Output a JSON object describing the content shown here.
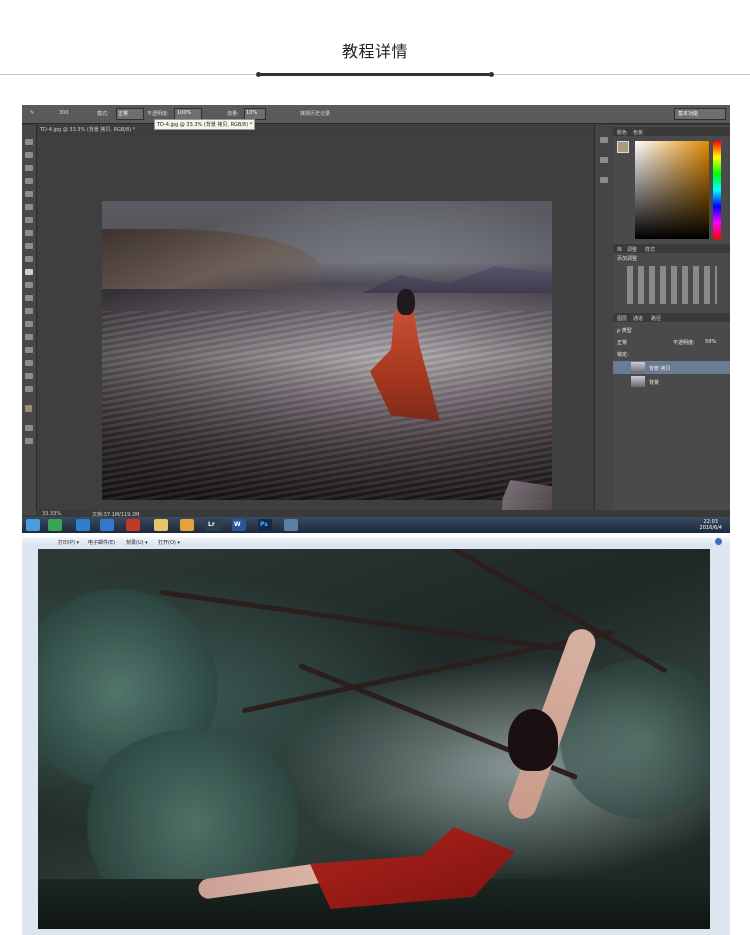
{
  "header": {
    "title": "教程详情"
  },
  "photoshop": {
    "options_bar": {
      "mode_label": "模式:",
      "mode_value": "正常",
      "opacity_label": "不透明度:",
      "opacity_value": "100%",
      "flow_label": "流量:",
      "flow_value": "10%",
      "history_label": "抹除历史记录",
      "workspace_value": "基本功能",
      "brush_size": "300"
    },
    "document_tab": "TD-4.jpg @ 33.3% (背景 拷贝, RGB/8) *",
    "tooltip": "TD-4.jpg @ 33.3% (背景 拷贝, RGB/8) *",
    "panels": {
      "color_tabs": [
        "颜色",
        "色板"
      ],
      "adjust_tabs": [
        "库",
        "调整",
        "样式"
      ],
      "adjust_title": "添加调整",
      "layers_tabs": [
        "图层",
        "通道",
        "路径"
      ],
      "layer_kind": "ρ 类型",
      "blend_mode": "正常",
      "opacity_label": "不透明度:",
      "opacity_value": "59%",
      "lock_label": "锁定:",
      "layers": [
        {
          "name": "背景 拷贝",
          "selected": true
        },
        {
          "name": "背景",
          "selected": false
        }
      ]
    },
    "status": {
      "zoom": "33.33%",
      "doc_size": "文档:37.1M/119.2M"
    },
    "taskbar": {
      "apps": [
        "Lr",
        "W",
        "Ps"
      ],
      "time": "22:03",
      "date": "2016/6/4"
    },
    "colors": {
      "ui_dark": "#3b3b3b",
      "selected_layer": "#6a7b94",
      "foreground_swatch": "#a89c7a"
    }
  },
  "viewer": {
    "menu": {
      "print": "打印(P) ▾",
      "email": "电子邮件(E)",
      "burn": "刻录(U) ▾",
      "open": "打开(O) ▾"
    },
    "help_icon": "help-icon"
  }
}
